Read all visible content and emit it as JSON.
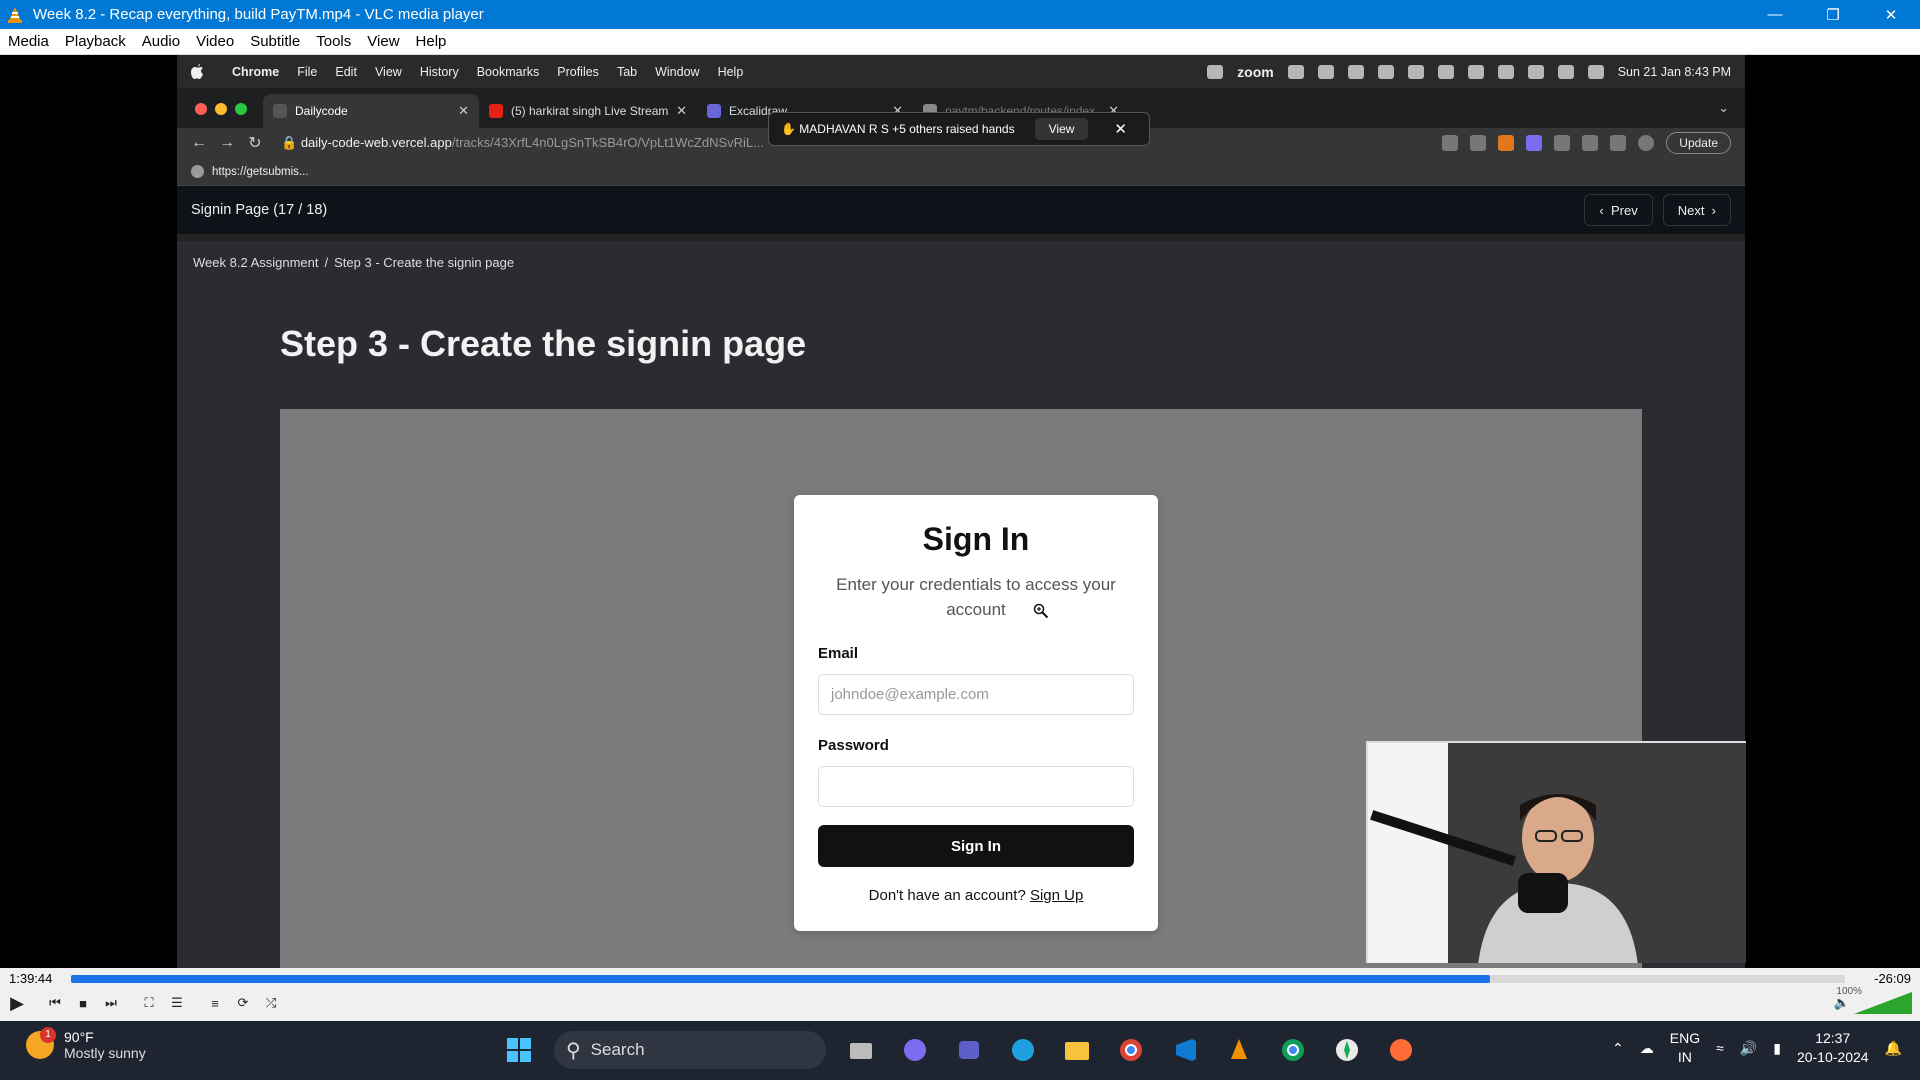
{
  "vlc": {
    "title": "Week 8.2 - Recap everything, build PayTM.mp4 - VLC media player",
    "menu": [
      "Media",
      "Playback",
      "Audio",
      "Video",
      "Subtitle",
      "Tools",
      "View",
      "Help"
    ],
    "time_elapsed": "1:39:44",
    "time_remaining": "-26:09",
    "progress": 0.8,
    "volume": "100%"
  },
  "mac": {
    "menu": [
      "Chrome",
      "File",
      "Edit",
      "View",
      "History",
      "Bookmarks",
      "Profiles",
      "Tab",
      "Window",
      "Help"
    ],
    "zoom_label": "zoom",
    "clock": "Sun 21 Jan  8:43 PM"
  },
  "browser": {
    "tabs": [
      {
        "title": "Dailycode",
        "color": "#3a3a3a"
      },
      {
        "title": "(5) harkirat singh Live Stream",
        "color": "#e62117"
      },
      {
        "title": "Excalidraw",
        "color": "#6965db"
      },
      {
        "title": "paytm/backend/routes/index...",
        "color": "#888888"
      }
    ],
    "url_main": "daily-code-web.vercel.app",
    "url_path": "/tracks/43XrfL4n0LgSnTkSB4rO/VpLt1WcZdNSvRiL...",
    "update_label": "Update",
    "bookmark": "https://getsubmis..."
  },
  "zoom_notice": {
    "text": "MADHAVAN R S +5 others raised hands",
    "view_label": "View"
  },
  "page": {
    "header_title": "Signin Page (17 / 18)",
    "prev_label": "Prev",
    "next_label": "Next",
    "breadcrumb_1": "Week 8.2 Assignment",
    "breadcrumb_sep": "/",
    "breadcrumb_2": "Step 3 - Create the signin page",
    "heading": "Step 3 - Create the signin page"
  },
  "signin": {
    "title": "Sign In",
    "subtitle": "Enter your credentials to access your account",
    "email_label": "Email",
    "email_placeholder": "johndoe@example.com",
    "password_label": "Password",
    "button_label": "Sign In",
    "footer_text": "Don't have an account?",
    "signup_link": "Sign Up"
  },
  "taskbar": {
    "weather_temp": "90°F",
    "weather_desc": "Mostly sunny",
    "weather_badge": "1",
    "search_label": "Search",
    "lang_1": "ENG",
    "lang_2": "IN",
    "time": "12:37",
    "date": "20-10-2024"
  }
}
